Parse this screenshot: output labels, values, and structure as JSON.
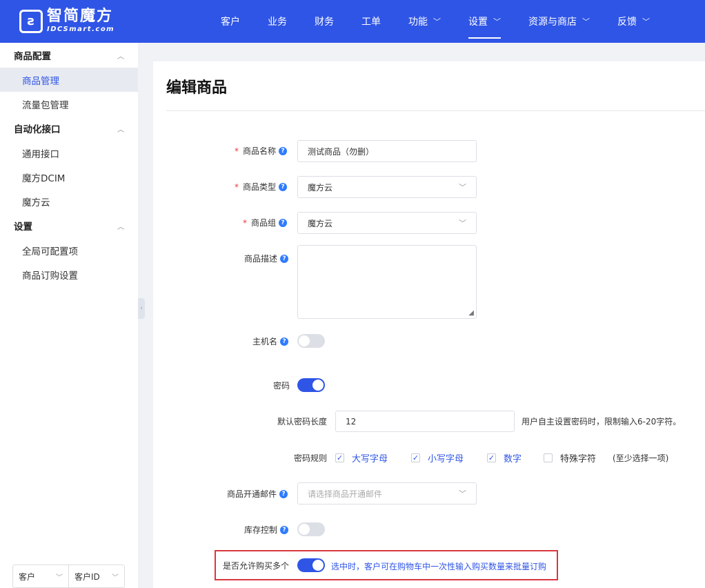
{
  "header": {
    "logo_cn": "智简魔方",
    "logo_en": "IDCSmart.com",
    "nav": [
      {
        "label": "客户",
        "has_dropdown": false
      },
      {
        "label": "业务",
        "has_dropdown": false
      },
      {
        "label": "财务",
        "has_dropdown": false
      },
      {
        "label": "工单",
        "has_dropdown": false
      },
      {
        "label": "功能",
        "has_dropdown": true
      },
      {
        "label": "设置",
        "has_dropdown": true,
        "active": true
      },
      {
        "label": "资源与商店",
        "has_dropdown": true
      },
      {
        "label": "反馈",
        "has_dropdown": true
      }
    ]
  },
  "sidebar": {
    "groups": [
      {
        "label": "商品配置",
        "items": [
          "商品管理",
          "流量包管理"
        ]
      },
      {
        "label": "自动化接口",
        "items": [
          "通用接口",
          "魔方DCIM",
          "魔方云"
        ]
      },
      {
        "label": "设置",
        "items": [
          "全局可配置项",
          "商品订购设置"
        ]
      }
    ],
    "active_item": "商品管理",
    "bottom": {
      "select1": "客户",
      "select2": "客户ID"
    }
  },
  "page": {
    "title": "编辑商品",
    "fields": {
      "name": {
        "label": "商品名称",
        "value": "测试商品（勿删）"
      },
      "type": {
        "label": "商品类型",
        "value": "魔方云"
      },
      "group": {
        "label": "商品组",
        "value": "魔方云"
      },
      "description": {
        "label": "商品描述",
        "value": ""
      },
      "hostname": {
        "label": "主机名",
        "on": false
      },
      "password": {
        "label": "密码",
        "on": true
      },
      "pwd_length": {
        "label": "默认密码长度",
        "value": "12",
        "note": "用户自主设置密码时，限制输入6-20字符。"
      },
      "pwd_rules": {
        "label": "密码规则",
        "options": [
          {
            "label": "大写字母",
            "checked": true
          },
          {
            "label": "小写字母",
            "checked": true
          },
          {
            "label": "数字",
            "checked": true
          },
          {
            "label": "特殊字符",
            "checked": false
          }
        ],
        "note": "(至少选择一项)"
      },
      "open_email": {
        "label": "商品开通邮件",
        "placeholder": "请选择商品开通邮件"
      },
      "stock": {
        "label": "库存控制",
        "on": false
      },
      "multi_buy": {
        "label": "是否允许购买多个",
        "on": true,
        "note": "选中时，客户可在购物车中一次性输入购买数量来批量订购"
      }
    }
  },
  "colors": {
    "primary": "#2f55e6",
    "required": "#e4393c",
    "highlight": "#d9363e"
  }
}
